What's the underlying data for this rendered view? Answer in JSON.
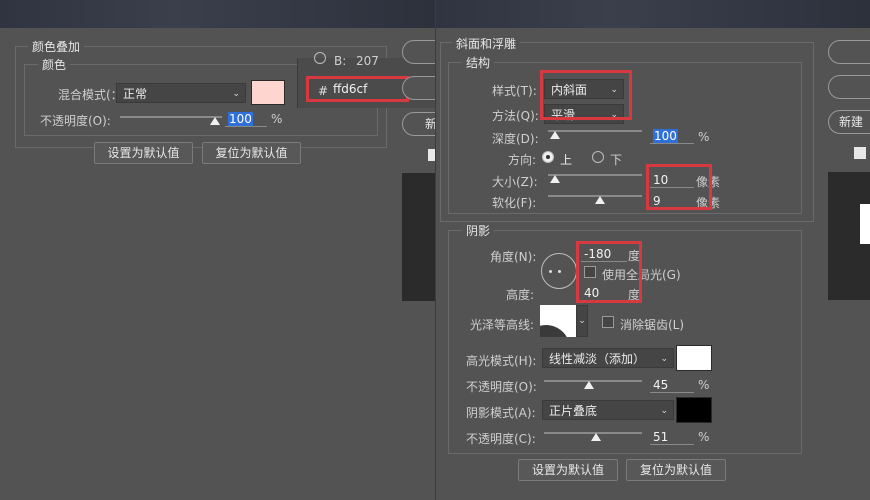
{
  "left": {
    "group_title": "颜色叠加",
    "sub_title": "颜色",
    "blend_label": "混合模式(：",
    "blend_value": "正常",
    "opacity_label": "不透明度(O):",
    "opacity_value": "100",
    "percent": "%",
    "set_default": "设置为默认值",
    "reset_default": "复位为默认值",
    "color_hex": "#ffd6cf",
    "picker_b_label": "B:",
    "picker_b_value": "207",
    "picker_hash": "#",
    "picker_hex_value": "ffd6cf",
    "right_button_new": "新",
    "checkbox_checked": true
  },
  "right": {
    "group_title": "斜面和浮雕",
    "structure_title": "结构",
    "style_label": "样式(T):",
    "style_value": "内斜面",
    "technique_label": "方法(Q):",
    "technique_value": "平滑",
    "depth_label": "深度(D):",
    "depth_value": "100",
    "percent": "%",
    "direction_label": "方向:",
    "direction_up": "上",
    "direction_down": "下",
    "size_label": "大小(Z):",
    "size_value": "10",
    "soften_label": "软化(F):",
    "soften_value": "9",
    "pixels": "像素",
    "shading_title": "阴影",
    "angle_label": "角度(N):",
    "angle_value": "-180",
    "degree": "度",
    "global_light_label": "使用全局光(G)",
    "altitude_label": "高度:",
    "altitude_value": "40",
    "gloss_label": "光泽等高线:",
    "anti_alias_label": "消除锯齿(L)",
    "highlight_mode_label": "高光模式(H):",
    "highlight_mode_value": "线性减淡（添加）",
    "highlight_color": "#ffffff",
    "highlight_opacity_label": "不透明度(O):",
    "highlight_opacity_value": "45",
    "shadow_mode_label": "阴影模式(A):",
    "shadow_mode_value": "正片叠底",
    "shadow_color": "#000000",
    "shadow_opacity_label": "不透明度(C):",
    "shadow_opacity_value": "51",
    "set_default": "设置为默认值",
    "reset_default": "复位为默认值",
    "right_button_new": "新建"
  },
  "accent": "#d8383f"
}
